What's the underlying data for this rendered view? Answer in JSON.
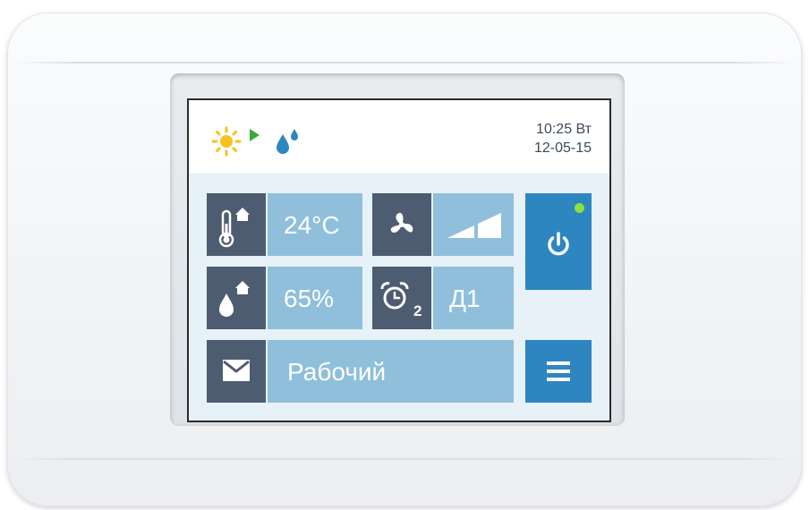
{
  "header": {
    "time_day": "10:25 Вт",
    "date": "12-05-15",
    "icons": [
      "sun-icon",
      "play-arrow-icon",
      "water-drops-icon"
    ]
  },
  "tiles": {
    "temperature": {
      "icon": "thermometer-home-icon",
      "value": "24°C"
    },
    "fan": {
      "icon": "fan-icon",
      "level_icon": "fan-speed-bars-icon"
    },
    "humidity": {
      "icon": "drop-home-icon",
      "value": "65%"
    },
    "schedule": {
      "icon": "alarm-clock-icon",
      "icon_number": "2",
      "value": "Д1"
    },
    "mode": {
      "icon": "envelope-icon",
      "value": "Рабочий"
    },
    "power": {
      "icon": "power-icon",
      "indicator_color": "#8fe03a"
    },
    "menu": {
      "icon": "menu-icon"
    }
  },
  "colors": {
    "dark_tile": "#4e5c71",
    "light_tile": "#8fbfda",
    "accent_blue": "#2e86c1",
    "screen_bg": "#e6f1f8"
  }
}
